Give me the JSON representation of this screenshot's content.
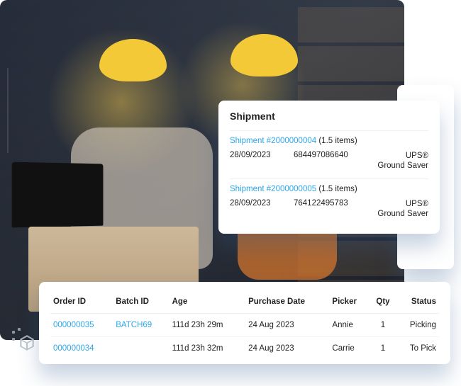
{
  "shipment": {
    "title": "Shipment",
    "blocks": [
      {
        "link_label": "Shipment #2000000004",
        "items_text": "(1.5 items)",
        "date": "28/09/2023",
        "tracking": "684497086640",
        "service": "UPS® Ground Saver"
      },
      {
        "link_label": "Shipment #2000000005",
        "items_text": "(1.5 items)",
        "date": "28/09/2023",
        "tracking": "764122495783",
        "service": "UPS® Ground Saver"
      }
    ]
  },
  "orders": {
    "headers": {
      "order_id": "Order ID",
      "batch_id": "Batch ID",
      "age": "Age",
      "purchase_date": "Purchase Date",
      "picker": "Picker",
      "qty": "Qty",
      "status": "Status"
    },
    "rows": [
      {
        "order_id": "000000035",
        "batch_id": "BATCH69",
        "age": "111d 23h 29m",
        "purchase_date": "24 Aug 2023",
        "picker": "Annie",
        "qty": "1",
        "status": "Picking"
      },
      {
        "order_id": "000000034",
        "batch_id": "",
        "age": "111d 23h 32m",
        "purchase_date": "24 Aug 2023",
        "picker": "Carrie",
        "qty": "1",
        "status": "To Pick"
      }
    ]
  }
}
